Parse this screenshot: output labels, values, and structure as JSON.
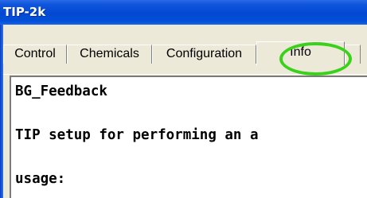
{
  "window": {
    "title": "TIP-2k"
  },
  "tabs": [
    {
      "label": "Control"
    },
    {
      "label": "Chemicals"
    },
    {
      "label": "Configuration"
    },
    {
      "label": "Info",
      "selected": true,
      "highlight_color": "#39d219"
    },
    {
      "label": ""
    }
  ],
  "info": {
    "lines": [
      "BG_Feedback",
      "TIP setup for performing an a",
      "usage:"
    ]
  }
}
